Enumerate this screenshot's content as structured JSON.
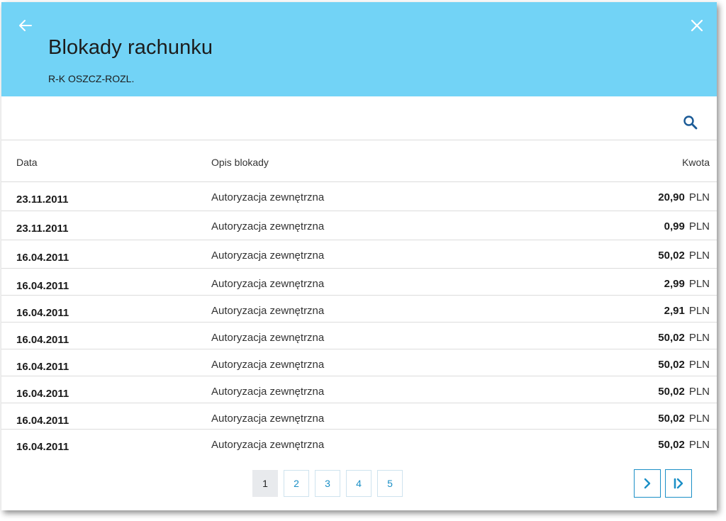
{
  "header": {
    "title": "Blokady rachunku",
    "subtitle": "R-K OSZCZ-ROZL.",
    "back_icon": "arrow-left-icon",
    "close_icon": "close-icon"
  },
  "search": {
    "icon": "search-icon"
  },
  "table": {
    "columns": {
      "date": "Data",
      "description": "Opis blokady",
      "amount": "Kwota"
    },
    "rows": [
      {
        "date": "23.11.2011",
        "description": "Autoryzacja zewnętrzna",
        "amount": "20,90",
        "currency": "PLN"
      },
      {
        "date": "23.11.2011",
        "description": "Autoryzacja zewnętrzna",
        "amount": "0,99",
        "currency": "PLN"
      },
      {
        "date": "16.04.2011",
        "description": "Autoryzacja zewnętrzna",
        "amount": "50,02",
        "currency": "PLN"
      },
      {
        "date": "16.04.2011",
        "description": "Autoryzacja zewnętrzna",
        "amount": "2,99",
        "currency": "PLN"
      },
      {
        "date": "16.04.2011",
        "description": "Autoryzacja zewnętrzna",
        "amount": "2,91",
        "currency": "PLN"
      },
      {
        "date": "16.04.2011",
        "description": "Autoryzacja zewnętrzna",
        "amount": "50,02",
        "currency": "PLN"
      },
      {
        "date": "16.04.2011",
        "description": "Autoryzacja zewnętrzna",
        "amount": "50,02",
        "currency": "PLN"
      },
      {
        "date": "16.04.2011",
        "description": "Autoryzacja zewnętrzna",
        "amount": "50,02",
        "currency": "PLN"
      },
      {
        "date": "16.04.2011",
        "description": "Autoryzacja zewnętrzna",
        "amount": "50,02",
        "currency": "PLN"
      },
      {
        "date": "16.04.2011",
        "description": "Autoryzacja zewnętrzna",
        "amount": "50,02",
        "currency": "PLN"
      }
    ]
  },
  "pagination": {
    "pages": [
      "1",
      "2",
      "3",
      "4",
      "5"
    ],
    "current": "1",
    "next_icon": "chevron-right-icon",
    "last_icon": "chevron-last-icon"
  },
  "colors": {
    "header_bg": "#72d3f6",
    "accent": "#1b8fc6",
    "icon_dark_blue": "#1a5a96"
  }
}
